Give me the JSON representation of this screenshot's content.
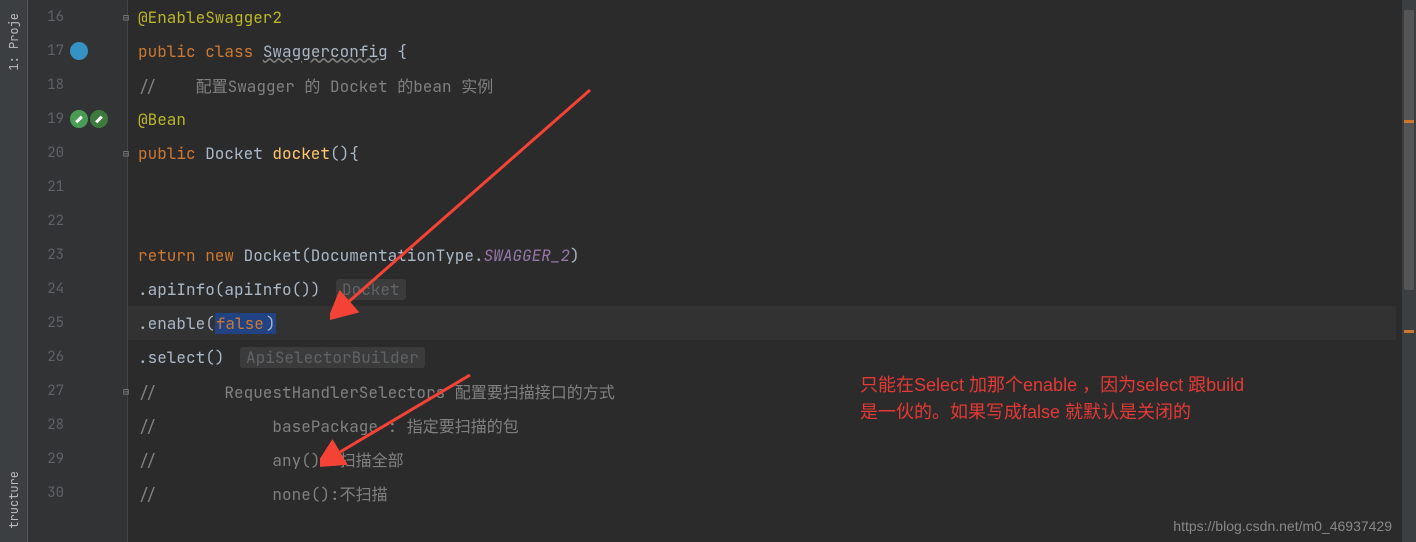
{
  "sidebar": {
    "project_label": "1: Proje",
    "structure_label": "tructure"
  },
  "gutter": {
    "lines": [
      "16",
      "17",
      "18",
      "19",
      "20",
      "21",
      "22",
      "23",
      "24",
      "25",
      "26",
      "27",
      "28",
      "29",
      "30"
    ]
  },
  "code": {
    "l16": {
      "ann": "@EnableSwagger2"
    },
    "l17": {
      "kw1": "public ",
      "kw2": "class ",
      "name": "Swaggerconfig",
      "brace": " {"
    },
    "l18": {
      "cm": "//    配置Swagger 的 Docket 的bean 实例"
    },
    "l19": {
      "ann": "@Bean"
    },
    "l20": {
      "kw1": "public ",
      "type": "Docket ",
      "method": "docket",
      "rest": "(){"
    },
    "l21": {
      "txt": ""
    },
    "l22": {
      "txt": ""
    },
    "l23": {
      "kw1": "return ",
      "kw2": "new ",
      "type": "Docket(DocumentationType.",
      "field": "SWAGGER_2",
      "rest": ")"
    },
    "l24": {
      "txt": ".apiInfo(apiInfo()) ",
      "hint": "Docket"
    },
    "l25": {
      "txt": ".enable(",
      "val": "false",
      "close": ")"
    },
    "l26": {
      "txt": ".select() ",
      "hint": "ApiSelectorBuilder"
    },
    "l27": {
      "cm": "//       RequestHandlerSelectors 配置要扫描接口的方式"
    },
    "l28": {
      "cm": "//            basePackage : 指定要扫描的包"
    },
    "l29": {
      "cm": "//            any() :扫描全部"
    },
    "l30": {
      "cm": "//            none():不扫描"
    }
  },
  "annotation": {
    "line1": "只能在Select 加那个enable ，因为select 跟build",
    "line2": "是一伙的。如果写成false 就默认是关闭的"
  },
  "watermark": "https://blog.csdn.net/m0_46937429"
}
